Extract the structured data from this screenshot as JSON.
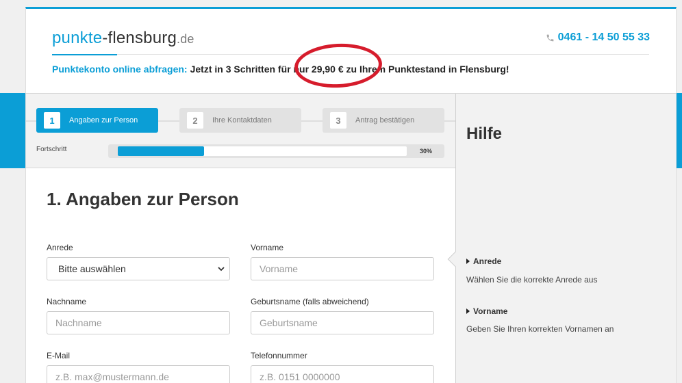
{
  "header": {
    "logo": {
      "part1": "punkte",
      "part2": "-flensburg",
      "part3": ".de"
    },
    "phone": "0461 - 14 50 55 33",
    "promo_accent": "Punktekonto online abfragen:",
    "promo_text": "Jetzt in 3 Schritten für nur 29,90 € zu Ihrem Punktestand in Flensburg!"
  },
  "steps": [
    {
      "number": "1",
      "label": "Angaben zur Person",
      "state": "active"
    },
    {
      "number": "2",
      "label": "Ihre Kontaktdaten",
      "state": "inactive"
    },
    {
      "number": "3",
      "label": "Antrag bestätigen",
      "state": "inactive"
    }
  ],
  "progress": {
    "label": "Fortschritt",
    "percent": 30,
    "percent_text": "30%"
  },
  "form": {
    "title": "1. Angaben zur Person",
    "anrede": {
      "label": "Anrede",
      "value": "Bitte auswählen"
    },
    "vorname": {
      "label": "Vorname",
      "placeholder": "Vorname"
    },
    "nachname": {
      "label": "Nachname",
      "placeholder": "Nachname"
    },
    "geburtsname": {
      "label": "Geburtsname (falls abweichend)",
      "placeholder": "Geburtsname"
    },
    "email": {
      "label": "E-Mail",
      "placeholder": "z.B. max@mustermann.de"
    },
    "telefon": {
      "label": "Telefonnummer",
      "placeholder": "z.B. 0151 0000000"
    }
  },
  "help": {
    "title": "Hilfe",
    "items": [
      {
        "heading": "Anrede",
        "text": "Wählen Sie die korrekte Anrede aus"
      },
      {
        "heading": "Vorname",
        "text": "Geben Sie Ihren korrekten Vornamen an"
      }
    ]
  },
  "colors": {
    "accent": "#0b9ed6",
    "annotation": "#d61c2c",
    "panel": "#f2f2f2"
  },
  "icons": {
    "phone": "phone-icon",
    "chevron": "chevron-down-icon",
    "bullet": "triangle-right-icon"
  }
}
